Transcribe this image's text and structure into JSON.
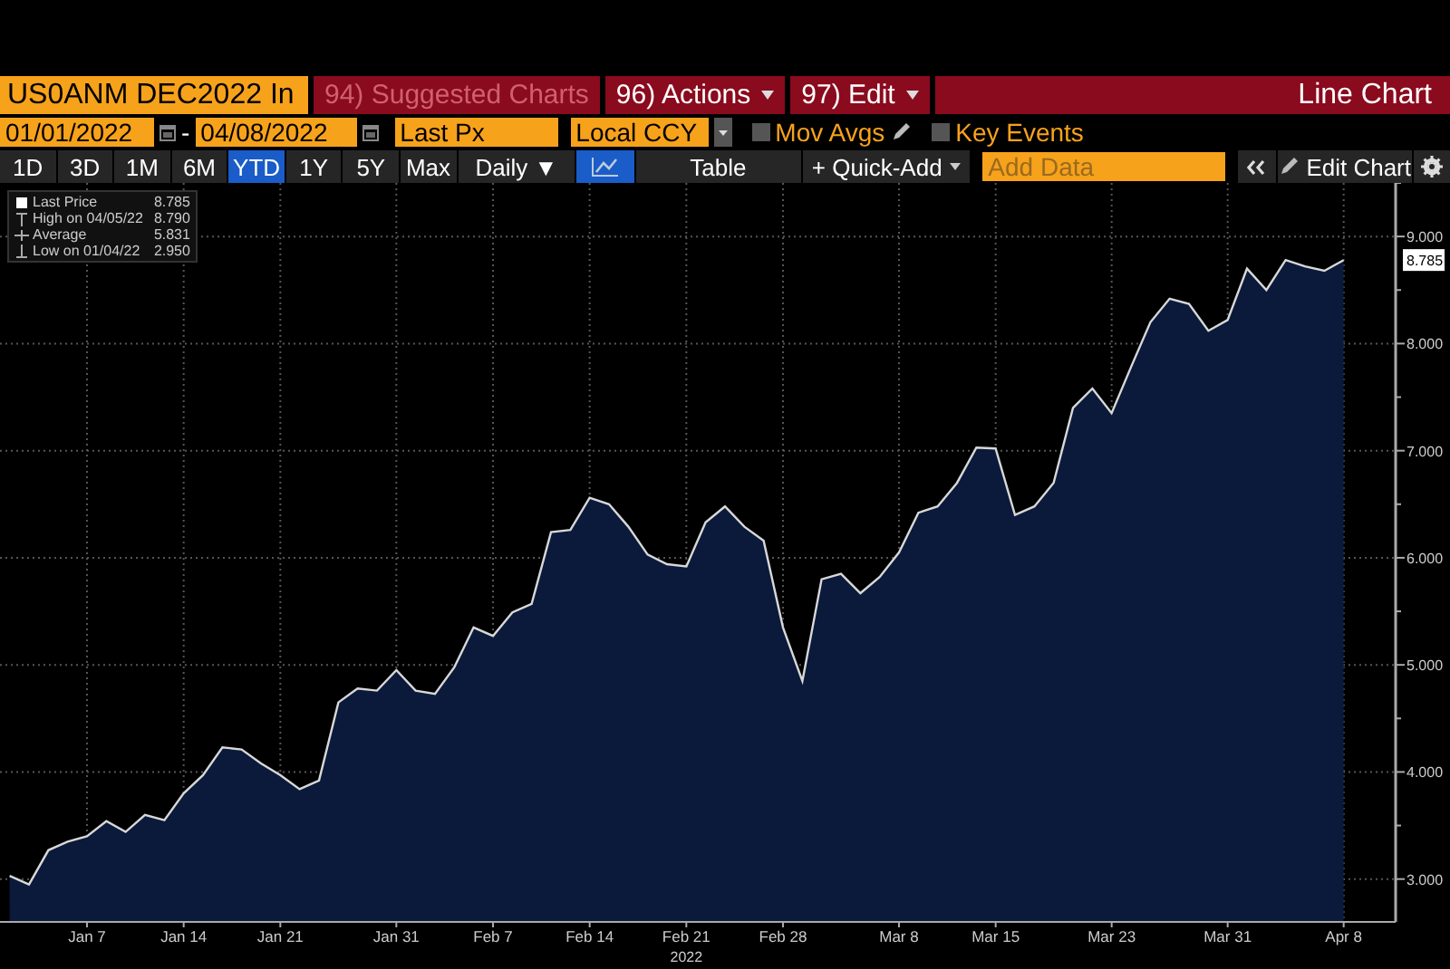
{
  "security": "US0ANM DEC2022 In",
  "menu": [
    {
      "label": "94) Suggested Charts",
      "disabled": true,
      "dropdown": false
    },
    {
      "label": "96) Actions",
      "disabled": false,
      "dropdown": true
    },
    {
      "label": "97) Edit",
      "disabled": false,
      "dropdown": true
    }
  ],
  "chart_type": "Line Chart",
  "range": {
    "start": "01/01/2022",
    "separator": "-",
    "end": "04/08/2022"
  },
  "field": "Last Px",
  "currency": "Local CCY",
  "toggles": [
    {
      "label": "Mov Avgs",
      "checked": false,
      "editable": true
    },
    {
      "label": "Key Events",
      "checked": false,
      "editable": false
    }
  ],
  "periods": [
    {
      "label": "1D",
      "selected": false
    },
    {
      "label": "3D",
      "selected": false
    },
    {
      "label": "1M",
      "selected": false
    },
    {
      "label": "6M",
      "selected": false
    },
    {
      "label": "YTD",
      "selected": true
    },
    {
      "label": "1Y",
      "selected": false
    },
    {
      "label": "5Y",
      "selected": false
    },
    {
      "label": "Max",
      "selected": false
    }
  ],
  "frequency": "Daily ▼",
  "views": [
    {
      "kind": "line",
      "selected": true
    },
    {
      "kind": "table",
      "label": "Table",
      "selected": false
    }
  ],
  "quick_add": "+ Quick-Add",
  "add_data": {
    "placeholder": "Add Data"
  },
  "edit_chart": "Edit Chart",
  "legend": [
    {
      "kind": "last",
      "value": "8.785"
    },
    {
      "kind": "high",
      "label": "High on 04/05/22",
      "value": "8.790"
    },
    {
      "kind": "average",
      "label": "Average",
      "value": "5.831"
    },
    {
      "kind": "low",
      "label": "Low on 01/04/22",
      "value": "2.950"
    }
  ],
  "last_price_tag": "8.785",
  "chart_data": {
    "type": "area",
    "grid": true,
    "xlabel": "2022",
    "categories": [
      null,
      null,
      null,
      null,
      "Jan 7",
      null,
      null,
      null,
      null,
      "Jan 14",
      null,
      null,
      null,
      null,
      "Jan 21",
      null,
      null,
      null,
      null,
      null,
      "Jan 31",
      null,
      null,
      null,
      null,
      "Feb 7",
      null,
      null,
      null,
      null,
      "Feb 14",
      null,
      null,
      null,
      null,
      "Feb 21",
      null,
      null,
      null,
      null,
      "Feb 28",
      null,
      null,
      null,
      null,
      null,
      "Mar 8",
      null,
      null,
      null,
      null,
      "Mar 15",
      null,
      null,
      null,
      null,
      null,
      "Mar 23",
      null,
      null,
      null,
      null,
      null,
      "Mar 31",
      null,
      null,
      null,
      null,
      null,
      "Apr 8"
    ],
    "series": [
      {
        "name": "Last Price",
        "color": "#0b1a3a",
        "values": [
          3.03,
          2.95,
          3.27,
          3.35,
          3.4,
          3.54,
          3.44,
          3.6,
          3.55,
          3.8,
          3.97,
          4.23,
          4.21,
          4.08,
          3.97,
          3.84,
          3.92,
          4.65,
          4.78,
          4.76,
          4.95,
          4.76,
          4.73,
          4.98,
          5.35,
          5.27,
          5.49,
          5.57,
          6.24,
          6.26,
          6.56,
          6.5,
          6.29,
          6.03,
          5.94,
          5.92,
          6.33,
          6.48,
          6.29,
          6.16,
          5.35,
          4.85,
          5.8,
          5.85,
          5.67,
          5.82,
          6.05,
          6.42,
          6.48,
          6.7,
          7.03,
          7.02,
          6.4,
          6.48,
          6.7,
          7.4,
          7.58,
          7.35,
          7.78,
          8.2,
          8.42,
          8.37,
          8.12,
          8.22,
          8.7,
          8.5,
          8.78,
          8.72,
          8.68,
          8.78
        ]
      }
    ],
    "ylim": [
      2.6,
      9.5
    ],
    "yticks": [
      {
        "value": 3,
        "label": "3.000"
      },
      {
        "value": 4,
        "label": "4.000"
      },
      {
        "value": 5,
        "label": "5.000"
      },
      {
        "value": 6,
        "label": "6.000"
      },
      {
        "value": 7,
        "label": "7.000"
      },
      {
        "value": 8,
        "label": "8.000"
      },
      {
        "value": 9,
        "label": "9.000"
      }
    ]
  }
}
